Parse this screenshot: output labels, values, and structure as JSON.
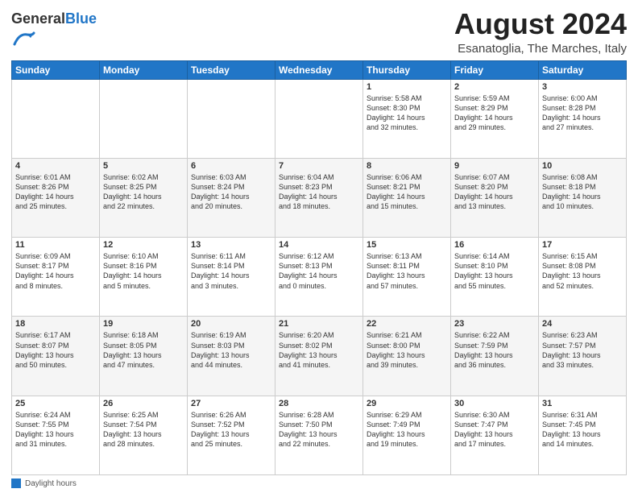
{
  "header": {
    "logo_general": "General",
    "logo_blue": "Blue",
    "main_title": "August 2024",
    "subtitle": "Esanatoglia, The Marches, Italy"
  },
  "footer": {
    "daylight_label": "Daylight hours"
  },
  "weekdays": [
    "Sunday",
    "Monday",
    "Tuesday",
    "Wednesday",
    "Thursday",
    "Friday",
    "Saturday"
  ],
  "weeks": [
    [
      {
        "day": "",
        "info": ""
      },
      {
        "day": "",
        "info": ""
      },
      {
        "day": "",
        "info": ""
      },
      {
        "day": "",
        "info": ""
      },
      {
        "day": "1",
        "info": "Sunrise: 5:58 AM\nSunset: 8:30 PM\nDaylight: 14 hours\nand 32 minutes."
      },
      {
        "day": "2",
        "info": "Sunrise: 5:59 AM\nSunset: 8:29 PM\nDaylight: 14 hours\nand 29 minutes."
      },
      {
        "day": "3",
        "info": "Sunrise: 6:00 AM\nSunset: 8:28 PM\nDaylight: 14 hours\nand 27 minutes."
      }
    ],
    [
      {
        "day": "4",
        "info": "Sunrise: 6:01 AM\nSunset: 8:26 PM\nDaylight: 14 hours\nand 25 minutes."
      },
      {
        "day": "5",
        "info": "Sunrise: 6:02 AM\nSunset: 8:25 PM\nDaylight: 14 hours\nand 22 minutes."
      },
      {
        "day": "6",
        "info": "Sunrise: 6:03 AM\nSunset: 8:24 PM\nDaylight: 14 hours\nand 20 minutes."
      },
      {
        "day": "7",
        "info": "Sunrise: 6:04 AM\nSunset: 8:23 PM\nDaylight: 14 hours\nand 18 minutes."
      },
      {
        "day": "8",
        "info": "Sunrise: 6:06 AM\nSunset: 8:21 PM\nDaylight: 14 hours\nand 15 minutes."
      },
      {
        "day": "9",
        "info": "Sunrise: 6:07 AM\nSunset: 8:20 PM\nDaylight: 14 hours\nand 13 minutes."
      },
      {
        "day": "10",
        "info": "Sunrise: 6:08 AM\nSunset: 8:18 PM\nDaylight: 14 hours\nand 10 minutes."
      }
    ],
    [
      {
        "day": "11",
        "info": "Sunrise: 6:09 AM\nSunset: 8:17 PM\nDaylight: 14 hours\nand 8 minutes."
      },
      {
        "day": "12",
        "info": "Sunrise: 6:10 AM\nSunset: 8:16 PM\nDaylight: 14 hours\nand 5 minutes."
      },
      {
        "day": "13",
        "info": "Sunrise: 6:11 AM\nSunset: 8:14 PM\nDaylight: 14 hours\nand 3 minutes."
      },
      {
        "day": "14",
        "info": "Sunrise: 6:12 AM\nSunset: 8:13 PM\nDaylight: 14 hours\nand 0 minutes."
      },
      {
        "day": "15",
        "info": "Sunrise: 6:13 AM\nSunset: 8:11 PM\nDaylight: 13 hours\nand 57 minutes."
      },
      {
        "day": "16",
        "info": "Sunrise: 6:14 AM\nSunset: 8:10 PM\nDaylight: 13 hours\nand 55 minutes."
      },
      {
        "day": "17",
        "info": "Sunrise: 6:15 AM\nSunset: 8:08 PM\nDaylight: 13 hours\nand 52 minutes."
      }
    ],
    [
      {
        "day": "18",
        "info": "Sunrise: 6:17 AM\nSunset: 8:07 PM\nDaylight: 13 hours\nand 50 minutes."
      },
      {
        "day": "19",
        "info": "Sunrise: 6:18 AM\nSunset: 8:05 PM\nDaylight: 13 hours\nand 47 minutes."
      },
      {
        "day": "20",
        "info": "Sunrise: 6:19 AM\nSunset: 8:03 PM\nDaylight: 13 hours\nand 44 minutes."
      },
      {
        "day": "21",
        "info": "Sunrise: 6:20 AM\nSunset: 8:02 PM\nDaylight: 13 hours\nand 41 minutes."
      },
      {
        "day": "22",
        "info": "Sunrise: 6:21 AM\nSunset: 8:00 PM\nDaylight: 13 hours\nand 39 minutes."
      },
      {
        "day": "23",
        "info": "Sunrise: 6:22 AM\nSunset: 7:59 PM\nDaylight: 13 hours\nand 36 minutes."
      },
      {
        "day": "24",
        "info": "Sunrise: 6:23 AM\nSunset: 7:57 PM\nDaylight: 13 hours\nand 33 minutes."
      }
    ],
    [
      {
        "day": "25",
        "info": "Sunrise: 6:24 AM\nSunset: 7:55 PM\nDaylight: 13 hours\nand 31 minutes."
      },
      {
        "day": "26",
        "info": "Sunrise: 6:25 AM\nSunset: 7:54 PM\nDaylight: 13 hours\nand 28 minutes."
      },
      {
        "day": "27",
        "info": "Sunrise: 6:26 AM\nSunset: 7:52 PM\nDaylight: 13 hours\nand 25 minutes."
      },
      {
        "day": "28",
        "info": "Sunrise: 6:28 AM\nSunset: 7:50 PM\nDaylight: 13 hours\nand 22 minutes."
      },
      {
        "day": "29",
        "info": "Sunrise: 6:29 AM\nSunset: 7:49 PM\nDaylight: 13 hours\nand 19 minutes."
      },
      {
        "day": "30",
        "info": "Sunrise: 6:30 AM\nSunset: 7:47 PM\nDaylight: 13 hours\nand 17 minutes."
      },
      {
        "day": "31",
        "info": "Sunrise: 6:31 AM\nSunset: 7:45 PM\nDaylight: 13 hours\nand 14 minutes."
      }
    ]
  ]
}
